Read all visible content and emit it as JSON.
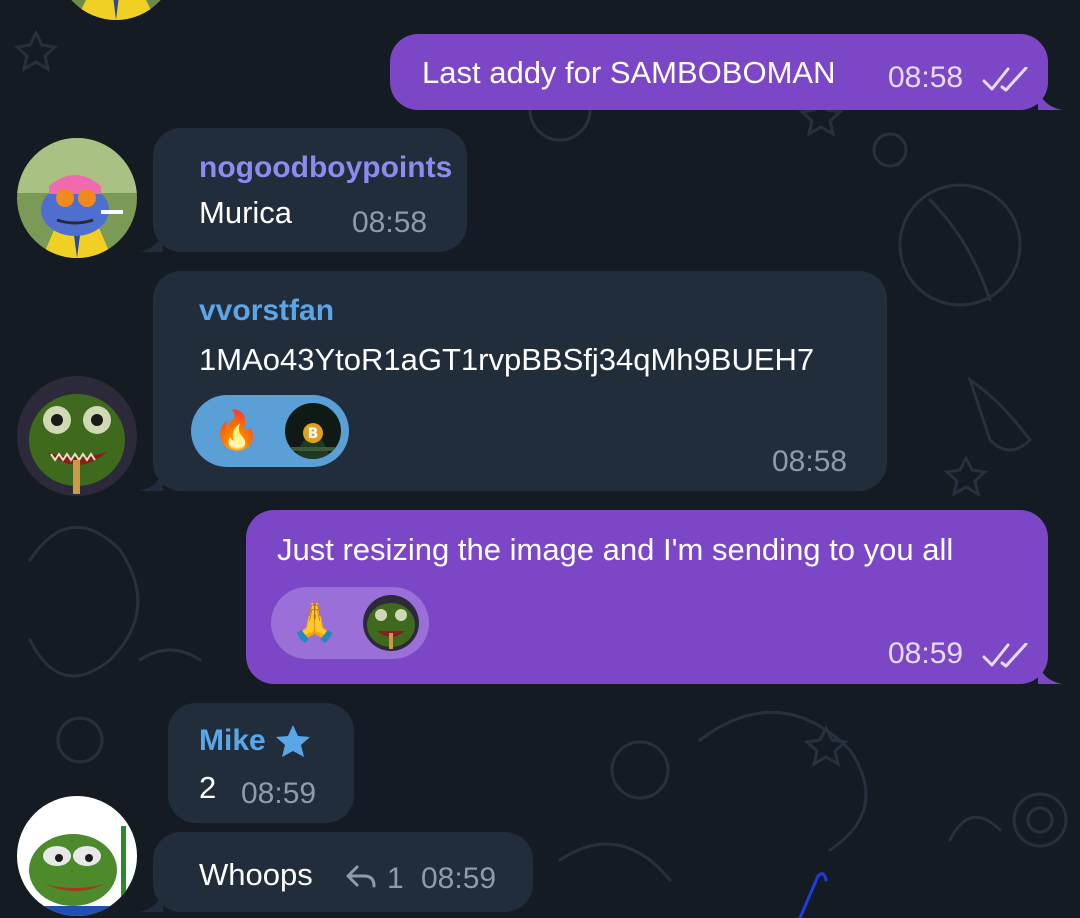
{
  "colors": {
    "background": "#141b22",
    "incoming_bubble": "#212d3b",
    "outgoing_bubble": "#7c47c7",
    "name_nogoodboypoints": "#8e8af0",
    "name_vvorstfan": "#5aa6e8",
    "name_mike": "#5aa6e8"
  },
  "messages": [
    {
      "type": "outgoing",
      "text": "Last addy for SAMBOBOMAN",
      "time": "08:58",
      "status_icon": "double-check-icon"
    },
    {
      "type": "incoming",
      "sender": "nogoodboypoints",
      "text": "Murica",
      "time": "08:58"
    },
    {
      "type": "incoming",
      "sender": "vvorstfan",
      "text": "1MAo43YtoR1aGT1rvpBBSfj34qMh9BUEH7",
      "time": "08:58",
      "reactions": {
        "emoji": "🔥",
        "reactor_icon": "hooded-bitcoin-avatar-icon"
      }
    },
    {
      "type": "outgoing",
      "text": "Just resizing the image and I'm sending to you all",
      "time": "08:59",
      "status_icon": "double-check-icon",
      "reactions": {
        "emoji": "🙏",
        "reactor_icon": "frog-avatar-icon"
      }
    },
    {
      "type": "incoming",
      "sender": "Mike",
      "sender_badge": "star-icon",
      "text": "2",
      "time": "08:59"
    },
    {
      "type": "incoming",
      "text": "Whoops",
      "replies": "1",
      "time": "08:59",
      "reply_icon": "reply-arrow-icon"
    }
  ]
}
